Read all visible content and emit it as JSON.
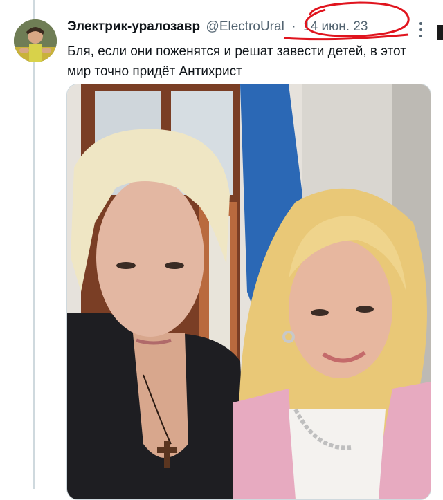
{
  "tweet": {
    "author_name": "Электрик-уралозавр",
    "author_handle": "@ElectroUral",
    "separator": "·",
    "date": "14 июн. 23",
    "text": "Бля, если они поженятся и решат завести детей, в этот мир точно придёт Антихрист",
    "avatar_icon": "user-avatar-photo",
    "more_icon": "more-vertical-icon",
    "media_description_icon": "photo-image"
  },
  "colors": {
    "text_primary": "#0f1419",
    "text_secondary": "#536471",
    "annotation_red": "#e0141e"
  }
}
